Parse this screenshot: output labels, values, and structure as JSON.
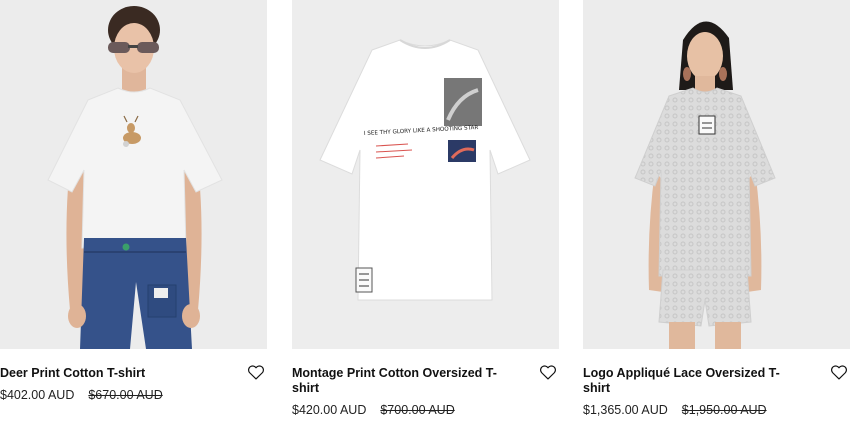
{
  "products": [
    {
      "name": "Deer Print Cotton T-shirt",
      "price": "$402.00 AUD",
      "original_price": "$670.00 AUD",
      "wishlist_icon": "heart-outline-icon"
    },
    {
      "name": "Montage Print Cotton Oversized T-shirt",
      "price": "$420.00 AUD",
      "original_price": "$700.00 AUD",
      "wishlist_icon": "heart-outline-icon",
      "print_text": "I SEE THY GLORY LIKE A SHOOTING STAR"
    },
    {
      "name": "Logo Appliqué Lace Oversized T-shirt",
      "price": "$1,365.00 AUD",
      "original_price": "$1,950.00 AUD",
      "wishlist_icon": "heart-outline-icon"
    }
  ],
  "colors": {
    "photo_background": "#ededed",
    "text": "#111111"
  }
}
